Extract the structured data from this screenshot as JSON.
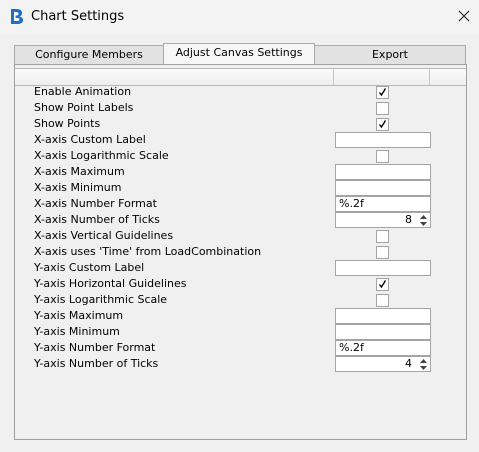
{
  "window": {
    "title": "Chart Settings",
    "icon": "app-logo-icon",
    "close_icon": "close-icon"
  },
  "tabs": [
    {
      "label": "Configure Members"
    },
    {
      "label": "Adjust Canvas Settings",
      "active": true
    },
    {
      "label": "Export"
    }
  ],
  "properties": [
    {
      "label": "Enable Animation",
      "type": "checkbox",
      "checked": true
    },
    {
      "label": "Show Point Labels",
      "type": "checkbox",
      "checked": false
    },
    {
      "label": "Show Points",
      "type": "checkbox",
      "checked": true
    },
    {
      "label": "X-axis Custom Label",
      "type": "text",
      "value": ""
    },
    {
      "label": "X-axis Logarithmic Scale",
      "type": "checkbox",
      "checked": false
    },
    {
      "label": "X-axis Maximum",
      "type": "text",
      "value": ""
    },
    {
      "label": "X-axis Minimum",
      "type": "text",
      "value": ""
    },
    {
      "label": "X-axis Number Format",
      "type": "text",
      "value": "%.2f"
    },
    {
      "label": "X-axis Number of Ticks",
      "type": "spinner",
      "value": "8"
    },
    {
      "label": "X-axis Vertical Guidelines",
      "type": "checkbox",
      "checked": false
    },
    {
      "label": "X-axis uses 'Time' from LoadCombination",
      "type": "checkbox",
      "checked": false
    },
    {
      "label": "Y-axis Custom Label",
      "type": "text",
      "value": ""
    },
    {
      "label": "Y-axis Horizontal Guidelines",
      "type": "checkbox",
      "checked": true
    },
    {
      "label": "Y-axis Logarithmic Scale",
      "type": "checkbox",
      "checked": false
    },
    {
      "label": "Y-axis Maximum",
      "type": "text",
      "value": ""
    },
    {
      "label": "Y-axis Minimum",
      "type": "text",
      "value": ""
    },
    {
      "label": "Y-axis Number Format",
      "type": "text",
      "value": "%.2f"
    },
    {
      "label": "Y-axis Number of Ticks",
      "type": "spinner",
      "value": "4"
    }
  ]
}
